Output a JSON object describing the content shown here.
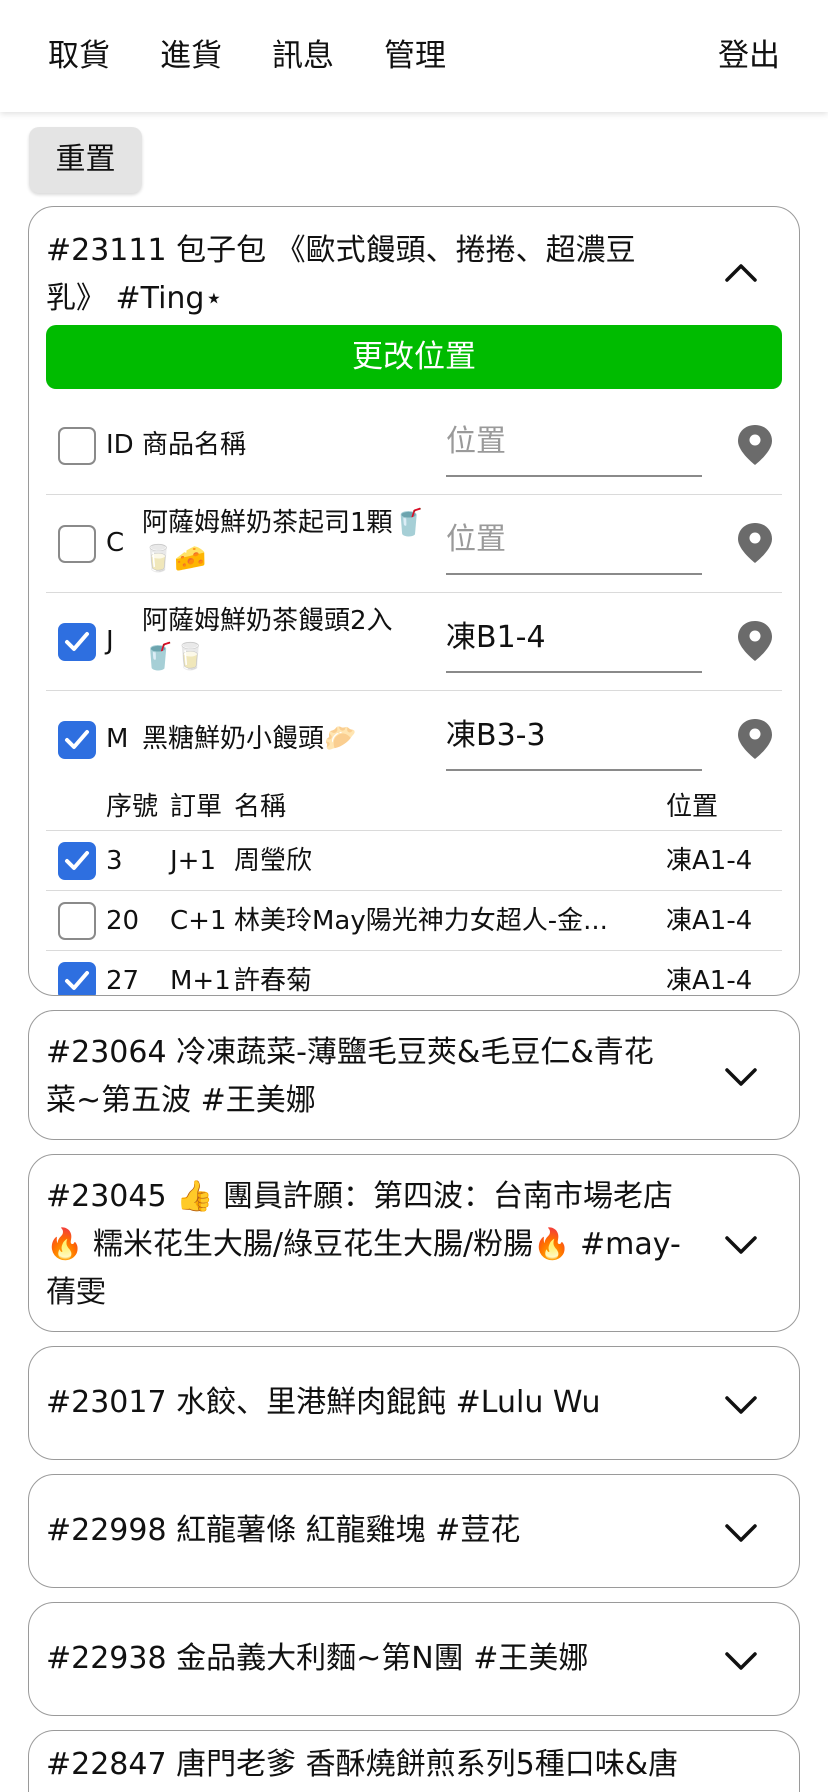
{
  "nav": {
    "items": [
      "取貨",
      "進貨",
      "訊息",
      "管理"
    ],
    "logout": "登出"
  },
  "reset_label": "重置",
  "expanded": {
    "title_line1": "#23111 包子包 《歐式饅頭、捲捲、超濃豆",
    "title_line2": "乳》 #Ting⋆",
    "change_location_label": "更改位置",
    "header": {
      "code": "ID",
      "name": "商品名稱",
      "location_placeholder": "位置"
    },
    "products": [
      {
        "checked": false,
        "code": "C",
        "name_line1": "阿薩姆鮮奶茶起司1顆🥤",
        "name_line2": "🥛🧀",
        "location": "",
        "placeholder": "位置"
      },
      {
        "checked": true,
        "code": "J",
        "name_line1": "阿薩姆鮮奶茶饅頭2入",
        "name_line2": "🥤🥛",
        "location": "凍B1-4",
        "placeholder": "位置"
      },
      {
        "checked": true,
        "code": "M",
        "name_line1": "黑糖鮮奶小饅頭🥟",
        "name_line2": "",
        "location": "凍B3-3",
        "placeholder": "位置"
      }
    ],
    "orders_header": {
      "no": "序號",
      "order": "訂單",
      "name": "名稱",
      "location": "位置"
    },
    "orders": [
      {
        "checked": true,
        "no": "3",
        "order": "J+1",
        "name": "周瑩欣",
        "location": "凍A1-4"
      },
      {
        "checked": false,
        "no": "20",
        "order": "C+1",
        "name": "林美玲May陽光神力女超人-金...",
        "location": "凍A1-4"
      },
      {
        "checked": true,
        "no": "27",
        "order": "M+1",
        "name": "許春菊",
        "location": "凍A1-4"
      }
    ]
  },
  "collapsed": [
    {
      "line1": "#23064 冷凍蔬菜-薄鹽毛豆莢&毛豆仁&青花",
      "line2": "菜~第五波 #王美娜",
      "line3": ""
    },
    {
      "line1": "#23045 👍 團員許願：第四波：台南市場老店",
      "line2": "🔥 糯米花生大腸/綠豆花生大腸/粉腸🔥 #may-",
      "line3": "蒨雯"
    },
    {
      "line1": "#23017 水餃、里港鮮肉餛飩 #Lulu Wu",
      "line2": "",
      "line3": ""
    },
    {
      "line1": "#22998 紅龍薯條 紅龍雞塊 #荳花",
      "line2": "",
      "line3": ""
    },
    {
      "line1": "#22938 金品義大利麵~第N團 #王美娜",
      "line2": "",
      "line3": ""
    },
    {
      "line1": "#22847 唐門老爹 香酥燒餅煎系列5種口味&唐",
      "line2": "",
      "line3": ""
    }
  ],
  "colors": {
    "accent_green": "#00bb00",
    "checkbox_blue": "#2e6fe0",
    "pin_gray": "#6b6b6b"
  },
  "icons": {
    "chevron_up": "chevron-up-icon",
    "chevron_down": "chevron-down-icon",
    "pin": "location-pin-icon",
    "check": "check-icon"
  }
}
